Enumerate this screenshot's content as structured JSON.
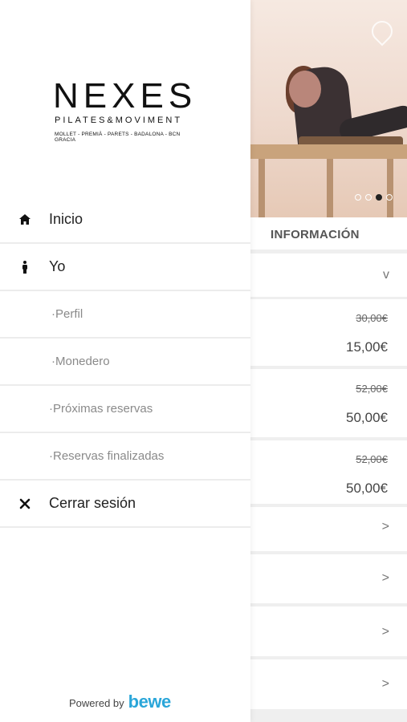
{
  "logo": {
    "title": "NEXES",
    "subtitle": "PILATES&MOVIMENT",
    "locations": "MOLLET - PREMIÀ - PARETS - BADALONA - BCN GRACIA"
  },
  "menu": [
    {
      "label": "Inicio",
      "icon": "home-icon"
    },
    {
      "label": "Yo",
      "icon": "person-icon"
    },
    {
      "label": "·Perfil"
    },
    {
      "label": "·Monedero"
    },
    {
      "label": "·Próximas reservas"
    },
    {
      "label": "·Reservas finalizadas"
    },
    {
      "label": "Cerrar sesión",
      "icon": "close-icon"
    }
  ],
  "powered": {
    "text": "Powered by",
    "brand": "bewe"
  },
  "background": {
    "info_header": "INFORMACIÓN",
    "prices": [
      {
        "old": "30,00€",
        "new": "15,00€"
      },
      {
        "old": "52,00€",
        "new": "50,00€"
      },
      {
        "old": "52,00€",
        "new": "50,00€"
      }
    ],
    "chevrons": {
      "down": "v",
      "right": ">"
    },
    "carousel": {
      "slides": 4,
      "active_index": 2
    }
  }
}
